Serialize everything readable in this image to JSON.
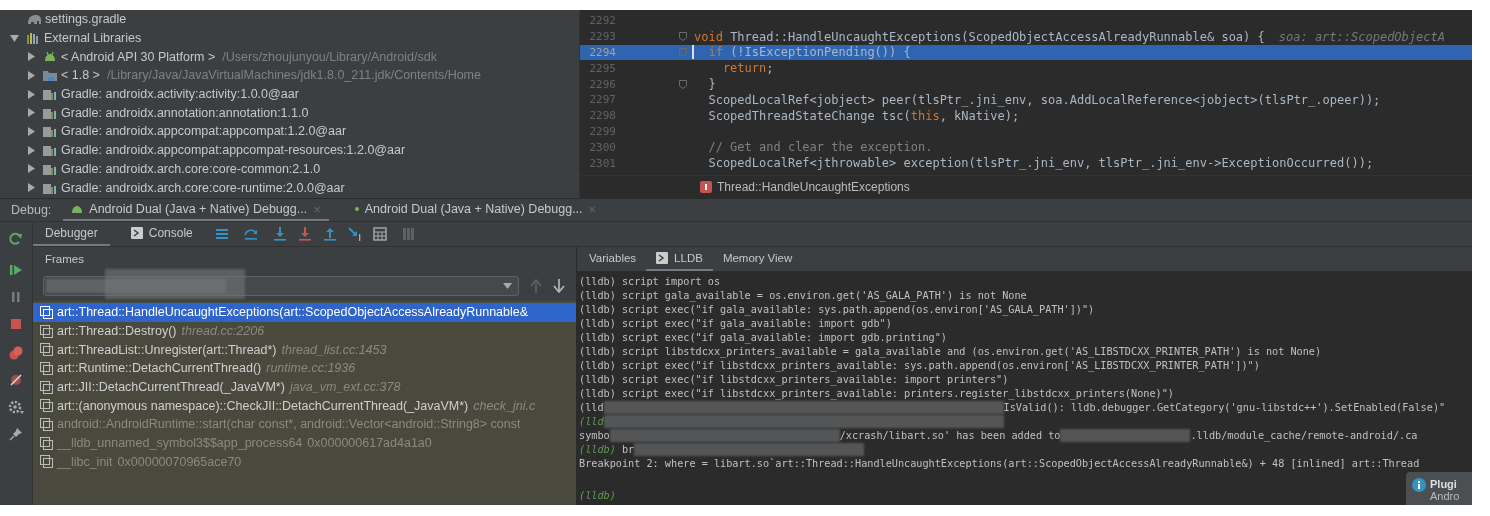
{
  "project_tree": {
    "items": [
      {
        "label": "settings.gradle",
        "kind": "gradle"
      },
      {
        "label": "External Libraries",
        "kind": "libraries",
        "expanded": true,
        "children": [
          {
            "label": "< Android API 30 Platform >",
            "path": "/Users/zhoujunyou/Library/Android/sdk",
            "kind": "android",
            "expanded": false
          },
          {
            "label": "< 1.8 >",
            "path": "/Library/Java/JavaVirtualMachines/jdk1.8.0_211.jdk/Contents/Home",
            "kind": "jdk",
            "expanded": false
          },
          {
            "label": "Gradle: androidx.activity:activity:1.0.0@aar",
            "kind": "library",
            "expanded": false
          },
          {
            "label": "Gradle: androidx.annotation:annotation:1.1.0",
            "kind": "library",
            "expanded": false
          },
          {
            "label": "Gradle: androidx.appcompat:appcompat:1.2.0@aar",
            "kind": "library",
            "expanded": false
          },
          {
            "label": "Gradle: androidx.appcompat:appcompat-resources:1.2.0@aar",
            "kind": "library",
            "expanded": false
          },
          {
            "label": "Gradle: androidx.arch.core:core-common:2.1.0",
            "kind": "library",
            "expanded": false
          },
          {
            "label": "Gradle: androidx.arch.core:core-runtime:2.0.0@aar",
            "kind": "library",
            "expanded": false
          }
        ]
      }
    ]
  },
  "editor": {
    "lines": [
      {
        "number": "2292",
        "current": false,
        "fold": false
      },
      {
        "number": "2293",
        "current": false,
        "fold": true,
        "tokens": [
          {
            "kind": "keyword",
            "text": "void"
          },
          {
            "kind": "plain",
            "text": " Thread::HandleUncaughtExceptions(ScopedObjectAccessAlreadyRunnable& soa) {"
          }
        ],
        "hint": "soa: art::ScopedObjectA"
      },
      {
        "number": "2294",
        "current": true,
        "fold": true,
        "tokens": [
          {
            "kind": "keyword",
            "text": "  if"
          },
          {
            "kind": "plain",
            "text": " (!IsExceptionPending()) {"
          }
        ]
      },
      {
        "number": "2295",
        "current": false,
        "fold": false,
        "tokens": [
          {
            "kind": "keyword",
            "text": "    return"
          },
          {
            "kind": "plain",
            "text": ";"
          }
        ]
      },
      {
        "number": "2296",
        "current": false,
        "fold": true,
        "tokens": [
          {
            "kind": "plain",
            "text": "  }"
          }
        ]
      },
      {
        "number": "2297",
        "current": false,
        "fold": false,
        "tokens": [
          {
            "kind": "plain",
            "text": "  ScopedLocalRef<jobject> peer(tlsPtr_.jni_env, soa.AddLocalReference<jobject>(tlsPtr_.opeer));"
          }
        ]
      },
      {
        "number": "2298",
        "current": false,
        "fold": false,
        "tokens": [
          {
            "kind": "plain",
            "text": "  ScopedThreadStateChange tsc("
          },
          {
            "kind": "keyword",
            "text": "this"
          },
          {
            "kind": "plain",
            "text": ", kNative);"
          }
        ]
      },
      {
        "number": "2299",
        "current": false,
        "fold": false
      },
      {
        "number": "2300",
        "current": false,
        "fold": false,
        "tokens": [
          {
            "kind": "comment",
            "text": "  // Get and clear the exception."
          }
        ]
      },
      {
        "number": "2301",
        "current": false,
        "fold": false,
        "tokens": [
          {
            "kind": "plain",
            "text": "  ScopedLocalRef<jthrowable> exception(tlsPtr_.jni_env, tlsPtr_.jni_env->ExceptionOccurred());"
          }
        ]
      }
    ],
    "breadcrumb": "Thread::HandleUncaughtExceptions"
  },
  "debug_bar": {
    "label": "Debug:",
    "sessions": [
      {
        "label": "Android Dual (Java + Native) Debugg...",
        "close": "×",
        "selected": true
      },
      {
        "label": "Android Dual (Java + Native) Debugg...",
        "close": "×",
        "selected": false
      }
    ]
  },
  "toolbar": {
    "tabs": [
      {
        "label": "Debugger",
        "selected": true
      },
      {
        "label": "Console",
        "selected": false
      }
    ]
  },
  "frames": {
    "title": "Frames",
    "items": [
      {
        "name": "art::Thread::HandleUncaughtExceptions(art::ScopedObjectAccessAlreadyRunnable&",
        "selected": true,
        "dimmed": false
      },
      {
        "name": "art::Thread::Destroy()",
        "location": "thread.cc:2206",
        "selected": false,
        "dimmed": false
      },
      {
        "name": "art::ThreadList::Unregister(art::Thread*)",
        "location": "thread_list.cc:1453",
        "selected": false,
        "dimmed": false
      },
      {
        "name": "art::Runtime::DetachCurrentThread()",
        "location": "runtime.cc:1936",
        "selected": false,
        "dimmed": false
      },
      {
        "name": "art::JII::DetachCurrentThread(_JavaVM*)",
        "location": "java_vm_ext.cc:378",
        "selected": false,
        "dimmed": false
      },
      {
        "name": "art::(anonymous namespace)::CheckJII::DetachCurrentThread(_JavaVM*)",
        "location": "check_jni.c",
        "selected": false,
        "dimmed": false
      },
      {
        "name": "android::AndroidRuntime::start(char const*, android::Vector<android::String8> const",
        "selected": false,
        "dimmed": true
      },
      {
        "name": "__lldb_unnamed_symbol3$$app_process64",
        "location": "0x000000617ad4a1a0",
        "selected": false,
        "dimmed": true
      },
      {
        "name": "__libc_init",
        "location": "0x00000070965ace70",
        "selected": false,
        "dimmed": true
      }
    ]
  },
  "console": {
    "tabs": [
      {
        "label": "Variables",
        "selected": false
      },
      {
        "label": "LLDB",
        "selected": true
      },
      {
        "label": "Memory View",
        "selected": false
      }
    ],
    "lines": [
      {
        "parts": [
          {
            "kind": "text",
            "text": "(lldb) script import os"
          }
        ]
      },
      {
        "parts": [
          {
            "kind": "text",
            "text": "(lldb) script gala_available = os.environ.get('AS_GALA_PATH') is not None"
          }
        ]
      },
      {
        "parts": [
          {
            "kind": "text",
            "text": "(lldb) script exec(\"if gala_available: sys.path.append(os.environ['AS_GALA_PATH'])\")"
          }
        ]
      },
      {
        "parts": [
          {
            "kind": "text",
            "text": "(lldb) script exec(\"if gala_available: import gdb\")"
          }
        ]
      },
      {
        "parts": [
          {
            "kind": "text",
            "text": "(lldb) script exec(\"if gala_available: import gdb.printing\")"
          }
        ]
      },
      {
        "parts": [
          {
            "kind": "text",
            "text": "(lldb) script libstdcxx_printers_available = gala_available and (os.environ.get('AS_LIBSTDCXX_PRINTER_PATH') is not None)"
          }
        ]
      },
      {
        "parts": [
          {
            "kind": "text",
            "text": "(lldb) script exec(\"if libstdcxx_printers_available: sys.path.append(os.environ['AS_LIBSTDCXX_PRINTER_PATH'])\")"
          }
        ]
      },
      {
        "parts": [
          {
            "kind": "text",
            "text": "(lldb) script exec(\"if libstdcxx_printers_available: import printers\")"
          }
        ]
      },
      {
        "parts": [
          {
            "kind": "text",
            "text": "(lldb) script exec(\"if libstdcxx_printers_available: printers.register_libstdcxx_printers(None)\")"
          }
        ]
      },
      {
        "parts": [
          {
            "kind": "text",
            "text": "(lld"
          },
          {
            "kind": "redacted-long"
          },
          {
            "kind": "text",
            "text": "IsValid(): lldb.debugger.GetCategory('gnu-libstdc++').SetEnabled(False)\""
          }
        ]
      },
      {
        "parts": [
          {
            "kind": "prompt",
            "text": "(lld"
          },
          {
            "kind": "redacted-long"
          }
        ]
      },
      {
        "parts": [
          {
            "kind": "text",
            "text": "symbo"
          },
          {
            "kind": "redacted-medium"
          },
          {
            "kind": "text",
            "text": "/xcrash/libart.so' has been added to"
          },
          {
            "kind": "redacted-short"
          },
          {
            "kind": "text",
            "text": ".lldb/module_cache/remote-android/.ca"
          }
        ]
      },
      {
        "parts": [
          {
            "kind": "prompt",
            "text": "(lldb)"
          },
          {
            "kind": "text",
            "text": " br"
          },
          {
            "kind": "redacted-medium"
          }
        ]
      },
      {
        "parts": [
          {
            "kind": "text",
            "text": "Breakpoint 2: where = libart.so`art::Thread::HandleUncaughtExceptions(art::ScopedObjectAccessAlreadyRunnable&) + 48 [inlined] art::Thread"
          }
        ]
      }
    ],
    "input_prompt": "(lldb)",
    "notification": {
      "title": "Plugi",
      "text": "Andro"
    }
  }
}
